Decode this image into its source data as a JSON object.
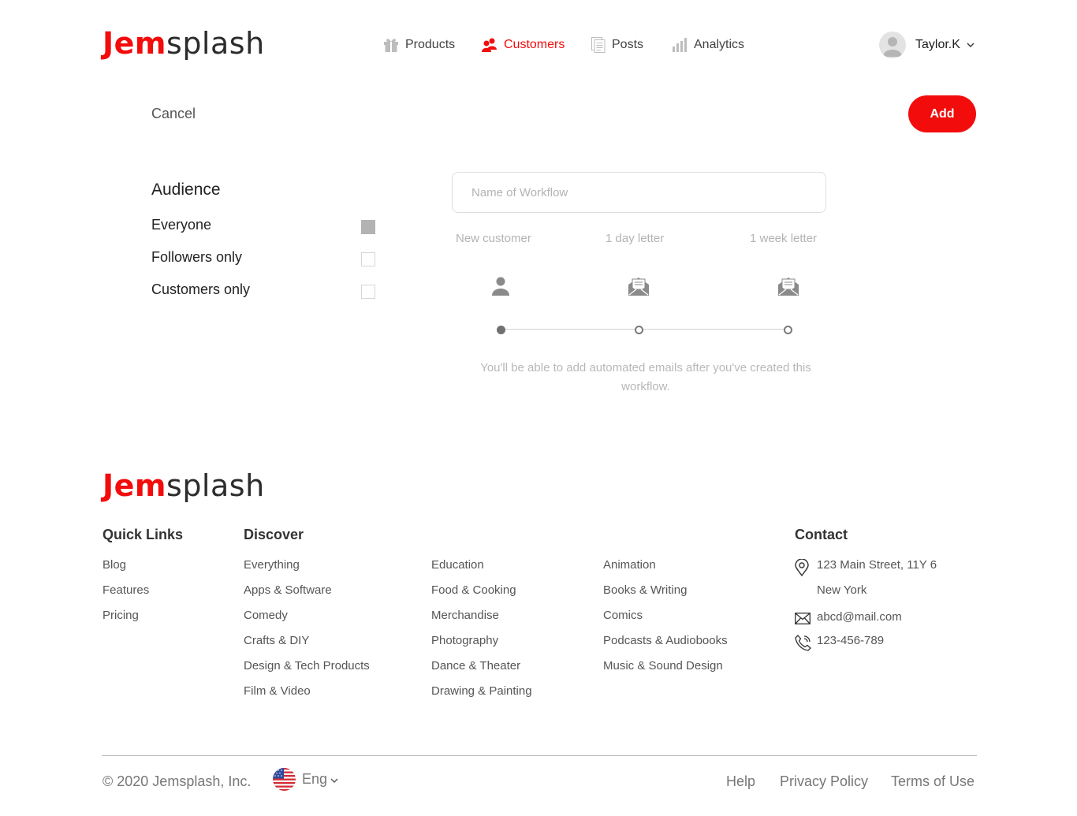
{
  "brand": {
    "logo_bold": "Jem",
    "logo_light": "splash",
    "accent_color": "#f20c0c"
  },
  "nav": {
    "items": [
      {
        "label": "Products",
        "icon": "gift-icon",
        "active": false
      },
      {
        "label": "Customers",
        "icon": "users-icon",
        "active": true
      },
      {
        "label": "Posts",
        "icon": "documents-icon",
        "active": false
      },
      {
        "label": "Analytics",
        "icon": "bar-chart-icon",
        "active": false
      }
    ]
  },
  "user": {
    "name": "Taylor.K",
    "avatar_icon": "user-avatar-icon",
    "menu_icon": "chevron-down-icon"
  },
  "actions": {
    "cancel_label": "Cancel",
    "add_label": "Add"
  },
  "audience": {
    "title": "Audience",
    "options": [
      {
        "label": "Everyone",
        "checked": true
      },
      {
        "label": "Followers only",
        "checked": false
      },
      {
        "label": "Customers only",
        "checked": false
      }
    ]
  },
  "workflow": {
    "name_placeholder": "Name of Workflow",
    "name_value": "",
    "steps": [
      {
        "label": "New  customer",
        "icon": "person-icon",
        "state": "done"
      },
      {
        "label": "1 day letter",
        "icon": "open-envelope-icon",
        "state": "pending"
      },
      {
        "label": "1 week letter",
        "icon": "open-envelope-icon",
        "state": "pending"
      }
    ],
    "note": "You'll be able to add automated emails after you've created this workflow."
  },
  "footer": {
    "quick_links": {
      "title": "Quick Links",
      "items": [
        "Blog",
        "Features",
        "Pricing"
      ]
    },
    "discover": {
      "title": "Discover",
      "columns": [
        [
          "Everything",
          "Apps & Software",
          "Comedy",
          "Crafts & DIY",
          "Design & Tech Products",
          "Film & Video"
        ],
        [
          "Education",
          "Food & Cooking",
          "Merchandise",
          "Photography",
          "Dance & Theater",
          "Drawing & Painting"
        ],
        [
          "Animation",
          "Books & Writing",
          "Comics",
          "Podcasts & Audiobooks",
          "Music & Sound Design"
        ]
      ]
    },
    "contact": {
      "title": "Contact",
      "address_line1": "123 Main Street, 11Y 6",
      "address_line2": "New York",
      "email": "abcd@mail.com",
      "phone": "123-456-789"
    },
    "copyright": "© 2020 Jemsplash, Inc.",
    "language": {
      "label": "Eng",
      "flag_icon": "us-flag-icon"
    },
    "bottom_links": [
      "Help",
      "Privacy Policy",
      "Terms of Use"
    ]
  }
}
